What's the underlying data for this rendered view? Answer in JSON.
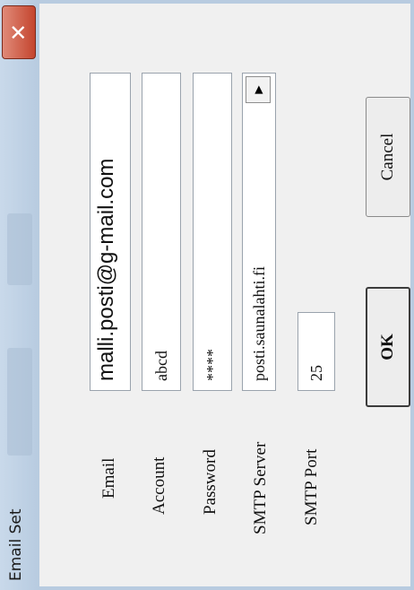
{
  "window": {
    "title": "Email Set",
    "close_glyph": "✕"
  },
  "form": {
    "email_label": "Email",
    "email_value": "malli.posti@g-mail.com",
    "account_label": "Account",
    "account_value": "abcd",
    "password_label": "Password",
    "password_value": "****",
    "smtp_server_label": "SMTP Server",
    "smtp_server_value": "posti.saunalahti.fi",
    "smtp_server_arrow": "▶",
    "smtp_port_label": "SMTP Port",
    "smtp_port_value": "25"
  },
  "buttons": {
    "ok_label": "OK",
    "cancel_label": "Cancel"
  }
}
